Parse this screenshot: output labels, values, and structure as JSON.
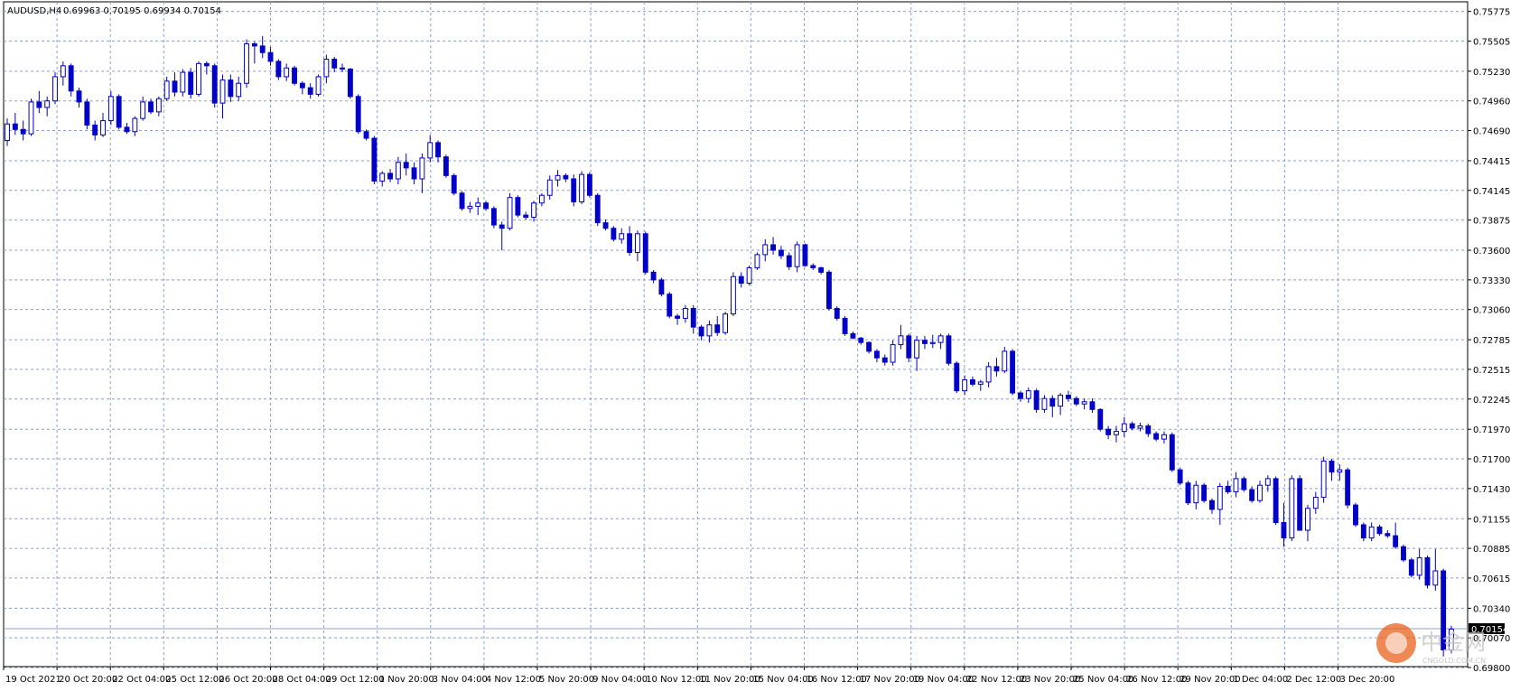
{
  "header": {
    "symbol": "AUDUSD,H4",
    "ohlc": "0.69963 0.70195 0.69934 0.70154"
  },
  "watermark": {
    "cn_text": "中金网",
    "en_text": "CNGOLD.COM.CN",
    "brand_color": "#e8601c"
  },
  "colors": {
    "candle": "#0000c8",
    "grid": "#8ca0c8",
    "price_line": "#8ca0c8",
    "price_tag_bg": "#000000",
    "price_tag_text": "#ffffff"
  },
  "chart_data": {
    "type": "candlestick",
    "symbol": "AUDUSD",
    "timeframe": "H4",
    "ylim": [
      0.698,
      0.7578
    ],
    "current_price": "0.70154",
    "grid": true,
    "y_ticks": [
      "0.75775",
      "0.75505",
      "0.75230",
      "0.74960",
      "0.74690",
      "0.74415",
      "0.74145",
      "0.73875",
      "0.73600",
      "0.73330",
      "0.73060",
      "0.72785",
      "0.72515",
      "0.72245",
      "0.71970",
      "0.71700",
      "0.71430",
      "0.71155",
      "0.70885",
      "0.70615",
      "0.70340",
      "0.70070",
      "0.69800"
    ],
    "x_ticks": [
      "19 Oct 2021",
      "20 Oct 20:00",
      "22 Oct 04:00",
      "25 Oct 12:00",
      "26 Oct 20:00",
      "28 Oct 04:00",
      "29 Oct 12:00",
      "1 Nov 20:00",
      "3 Nov 04:00",
      "4 Nov 12:00",
      "5 Nov 20:00",
      "9 Nov 04:00",
      "10 Nov 12:00",
      "11 Nov 20:00",
      "15 Nov 04:00",
      "16 Nov 12:00",
      "17 Nov 20:00",
      "19 Nov 04:00",
      "22 Nov 12:00",
      "23 Nov 20:00",
      "25 Nov 04:00",
      "26 Nov 12:00",
      "29 Nov 20:00",
      "1 Dec 04:00",
      "2 Dec 12:00",
      "3 Dec 20:00"
    ],
    "candles": [
      [
        0.746,
        0.748,
        0.7455,
        0.7475
      ],
      [
        0.7475,
        0.7485,
        0.7465,
        0.747
      ],
      [
        0.747,
        0.7478,
        0.746,
        0.7466
      ],
      [
        0.7466,
        0.7498,
        0.7464,
        0.7495
      ],
      [
        0.7495,
        0.7505,
        0.7485,
        0.749
      ],
      [
        0.749,
        0.75,
        0.7482,
        0.7496
      ],
      [
        0.7496,
        0.7522,
        0.7493,
        0.7518
      ],
      [
        0.7518,
        0.7532,
        0.751,
        0.7528
      ],
      [
        0.7528,
        0.753,
        0.75,
        0.7505
      ],
      [
        0.7505,
        0.7508,
        0.749,
        0.7495
      ],
      [
        0.7495,
        0.7498,
        0.747,
        0.7474
      ],
      [
        0.7474,
        0.7478,
        0.746,
        0.7465
      ],
      [
        0.7465,
        0.7485,
        0.7463,
        0.7478
      ],
      [
        0.7478,
        0.7505,
        0.7474,
        0.75
      ],
      [
        0.75,
        0.7502,
        0.747,
        0.7472
      ],
      [
        0.7472,
        0.7476,
        0.7466,
        0.7468
      ],
      [
        0.7468,
        0.7482,
        0.7464,
        0.748
      ],
      [
        0.748,
        0.75,
        0.7478,
        0.7495
      ],
      [
        0.7495,
        0.7498,
        0.7484,
        0.7486
      ],
      [
        0.7486,
        0.75,
        0.7482,
        0.7498
      ],
      [
        0.7498,
        0.7518,
        0.7496,
        0.7514
      ],
      [
        0.7514,
        0.7522,
        0.75,
        0.7504
      ],
      [
        0.7504,
        0.7525,
        0.75,
        0.7522
      ],
      [
        0.7522,
        0.7526,
        0.7498,
        0.7502
      ],
      [
        0.7502,
        0.7532,
        0.75,
        0.753
      ],
      [
        0.753,
        0.7532,
        0.752,
        0.7528
      ],
      [
        0.7528,
        0.753,
        0.749,
        0.7494
      ],
      [
        0.7494,
        0.752,
        0.748,
        0.7515
      ],
      [
        0.7515,
        0.752,
        0.7495,
        0.75
      ],
      [
        0.75,
        0.7518,
        0.7496,
        0.7512
      ],
      [
        0.7512,
        0.7552,
        0.7508,
        0.7548
      ],
      [
        0.7548,
        0.755,
        0.753,
        0.7546
      ],
      [
        0.7546,
        0.7555,
        0.7535,
        0.754
      ],
      [
        0.754,
        0.7545,
        0.7528,
        0.7532
      ],
      [
        0.7532,
        0.7534,
        0.7515,
        0.7518
      ],
      [
        0.7518,
        0.753,
        0.7514,
        0.7526
      ],
      [
        0.7526,
        0.7528,
        0.751,
        0.7512
      ],
      [
        0.7512,
        0.7514,
        0.7502,
        0.7508
      ],
      [
        0.7508,
        0.7512,
        0.7498,
        0.7502
      ],
      [
        0.7502,
        0.752,
        0.75,
        0.7518
      ],
      [
        0.7518,
        0.7538,
        0.7512,
        0.7534
      ],
      [
        0.7534,
        0.7536,
        0.7522,
        0.7526
      ],
      [
        0.7526,
        0.753,
        0.7522,
        0.7525
      ],
      [
        0.7525,
        0.7526,
        0.7498,
        0.75
      ],
      [
        0.75,
        0.7502,
        0.7466,
        0.7468
      ],
      [
        0.7468,
        0.747,
        0.746,
        0.7462
      ],
      [
        0.7462,
        0.7464,
        0.742,
        0.7423
      ],
      [
        0.7423,
        0.7432,
        0.7418,
        0.743
      ],
      [
        0.743,
        0.7434,
        0.7422,
        0.7425
      ],
      [
        0.7425,
        0.7445,
        0.742,
        0.744
      ],
      [
        0.744,
        0.7448,
        0.7428,
        0.7435
      ],
      [
        0.7435,
        0.744,
        0.742,
        0.7425
      ],
      [
        0.7425,
        0.7448,
        0.7412,
        0.7444
      ],
      [
        0.7444,
        0.7465,
        0.744,
        0.7458
      ],
      [
        0.7458,
        0.746,
        0.744,
        0.7445
      ],
      [
        0.7445,
        0.7447,
        0.7426,
        0.7428
      ],
      [
        0.7428,
        0.743,
        0.741,
        0.7412
      ],
      [
        0.7412,
        0.7414,
        0.7396,
        0.7398
      ],
      [
        0.7398,
        0.7404,
        0.7394,
        0.74
      ],
      [
        0.74,
        0.7408,
        0.7392,
        0.7403
      ],
      [
        0.7403,
        0.7405,
        0.7396,
        0.7398
      ],
      [
        0.7398,
        0.74,
        0.738,
        0.7383
      ],
      [
        0.7383,
        0.7386,
        0.736,
        0.738
      ],
      [
        0.738,
        0.7412,
        0.7378,
        0.7408
      ],
      [
        0.7408,
        0.741,
        0.739,
        0.7392
      ],
      [
        0.7392,
        0.7395,
        0.7388,
        0.739
      ],
      [
        0.739,
        0.7405,
        0.7386,
        0.7403
      ],
      [
        0.7403,
        0.7412,
        0.74,
        0.741
      ],
      [
        0.741,
        0.7428,
        0.7406,
        0.7424
      ],
      [
        0.7424,
        0.7433,
        0.7418,
        0.7428
      ],
      [
        0.7428,
        0.743,
        0.7422,
        0.7425
      ],
      [
        0.7425,
        0.7429,
        0.74,
        0.7404
      ],
      [
        0.7404,
        0.7432,
        0.7402,
        0.7429
      ],
      [
        0.7429,
        0.7431,
        0.7408,
        0.741
      ],
      [
        0.741,
        0.7412,
        0.7382,
        0.7385
      ],
      [
        0.7385,
        0.7388,
        0.7378,
        0.738
      ],
      [
        0.738,
        0.7382,
        0.7368,
        0.737
      ],
      [
        0.737,
        0.738,
        0.7366,
        0.7375
      ],
      [
        0.7375,
        0.7382,
        0.7355,
        0.7358
      ],
      [
        0.7358,
        0.7378,
        0.735,
        0.7375
      ],
      [
        0.7375,
        0.7377,
        0.7338,
        0.734
      ],
      [
        0.734,
        0.7342,
        0.733,
        0.7333
      ],
      [
        0.7333,
        0.7335,
        0.7318,
        0.732
      ],
      [
        0.732,
        0.7322,
        0.7298,
        0.73
      ],
      [
        0.73,
        0.7302,
        0.7292,
        0.7298
      ],
      [
        0.7298,
        0.731,
        0.7294,
        0.7307
      ],
      [
        0.7307,
        0.731,
        0.7284,
        0.729
      ],
      [
        0.729,
        0.7292,
        0.7278,
        0.7282
      ],
      [
        0.7282,
        0.7296,
        0.7276,
        0.7292
      ],
      [
        0.7292,
        0.73,
        0.7282,
        0.7285
      ],
      [
        0.7285,
        0.7304,
        0.7283,
        0.7302
      ],
      [
        0.7302,
        0.734,
        0.73,
        0.7336
      ],
      [
        0.7336,
        0.734,
        0.7326,
        0.733
      ],
      [
        0.733,
        0.7346,
        0.7328,
        0.7344
      ],
      [
        0.7344,
        0.7358,
        0.7342,
        0.7356
      ],
      [
        0.7356,
        0.737,
        0.735,
        0.7365
      ],
      [
        0.7365,
        0.7372,
        0.7356,
        0.736
      ],
      [
        0.736,
        0.7364,
        0.7352,
        0.7355
      ],
      [
        0.7355,
        0.7358,
        0.7342,
        0.7345
      ],
      [
        0.7345,
        0.7368,
        0.734,
        0.7365
      ],
      [
        0.7365,
        0.7366,
        0.7345,
        0.7346
      ],
      [
        0.7346,
        0.7348,
        0.7342,
        0.7344
      ],
      [
        0.7344,
        0.7345,
        0.7338,
        0.734
      ],
      [
        0.734,
        0.7342,
        0.7305,
        0.7307
      ],
      [
        0.7307,
        0.7309,
        0.7296,
        0.7298
      ],
      [
        0.7298,
        0.73,
        0.7282,
        0.7284
      ],
      [
        0.7284,
        0.7286,
        0.7279,
        0.728
      ],
      [
        0.728,
        0.7281,
        0.7274,
        0.7276
      ],
      [
        0.7276,
        0.7277,
        0.7266,
        0.7268
      ],
      [
        0.7268,
        0.727,
        0.7258,
        0.7262
      ],
      [
        0.7262,
        0.7265,
        0.7255,
        0.7258
      ],
      [
        0.7258,
        0.7278,
        0.7255,
        0.7274
      ],
      [
        0.7274,
        0.7292,
        0.727,
        0.7282
      ],
      [
        0.7282,
        0.7284,
        0.7258,
        0.7262
      ],
      [
        0.7262,
        0.7282,
        0.725,
        0.7278
      ],
      [
        0.7278,
        0.7282,
        0.727,
        0.7275
      ],
      [
        0.7275,
        0.7283,
        0.7271,
        0.7276
      ],
      [
        0.7276,
        0.7284,
        0.727,
        0.7282
      ],
      [
        0.7282,
        0.7284,
        0.7255,
        0.7257
      ],
      [
        0.7257,
        0.7259,
        0.723,
        0.7232
      ],
      [
        0.7232,
        0.7246,
        0.7228,
        0.7242
      ],
      [
        0.7242,
        0.7245,
        0.7236,
        0.7238
      ],
      [
        0.7238,
        0.7242,
        0.7232,
        0.724
      ],
      [
        0.724,
        0.7258,
        0.7235,
        0.7254
      ],
      [
        0.7254,
        0.7262,
        0.7245,
        0.725
      ],
      [
        0.725,
        0.7272,
        0.7248,
        0.7268
      ],
      [
        0.7268,
        0.727,
        0.7228,
        0.723
      ],
      [
        0.723,
        0.7232,
        0.7222,
        0.7225
      ],
      [
        0.7225,
        0.7235,
        0.7221,
        0.7232
      ],
      [
        0.7232,
        0.7234,
        0.7212,
        0.7215
      ],
      [
        0.7215,
        0.7228,
        0.7212,
        0.7225
      ],
      [
        0.7225,
        0.7228,
        0.7208,
        0.7218
      ],
      [
        0.7218,
        0.723,
        0.721,
        0.7228
      ],
      [
        0.7228,
        0.7232,
        0.7222,
        0.7225
      ],
      [
        0.7225,
        0.7227,
        0.7218,
        0.722
      ],
      [
        0.722,
        0.7225,
        0.7215,
        0.7222
      ],
      [
        0.7222,
        0.7225,
        0.7212,
        0.7215
      ],
      [
        0.7215,
        0.7216,
        0.7195,
        0.7197
      ],
      [
        0.7197,
        0.72,
        0.7188,
        0.7192
      ],
      [
        0.7192,
        0.72,
        0.7185,
        0.7195
      ],
      [
        0.7195,
        0.7208,
        0.719,
        0.7202
      ],
      [
        0.7202,
        0.7204,
        0.7196,
        0.7198
      ],
      [
        0.7198,
        0.7203,
        0.7195,
        0.72
      ],
      [
        0.72,
        0.7202,
        0.719,
        0.7193
      ],
      [
        0.7193,
        0.7195,
        0.7186,
        0.7188
      ],
      [
        0.7188,
        0.7195,
        0.7184,
        0.7192
      ],
      [
        0.7192,
        0.7194,
        0.7158,
        0.716
      ],
      [
        0.716,
        0.7162,
        0.7146,
        0.7148
      ],
      [
        0.7148,
        0.715,
        0.7128,
        0.713
      ],
      [
        0.713,
        0.715,
        0.7124,
        0.7146
      ],
      [
        0.7146,
        0.7148,
        0.713,
        0.7132
      ],
      [
        0.7132,
        0.7134,
        0.712,
        0.7124
      ],
      [
        0.7124,
        0.7148,
        0.711,
        0.7145
      ],
      [
        0.7145,
        0.715,
        0.7138,
        0.714
      ],
      [
        0.714,
        0.7158,
        0.7135,
        0.7152
      ],
      [
        0.7152,
        0.7154,
        0.714,
        0.7142
      ],
      [
        0.7142,
        0.7145,
        0.713,
        0.7132
      ],
      [
        0.7132,
        0.715,
        0.713,
        0.7146
      ],
      [
        0.7146,
        0.7155,
        0.714,
        0.7152
      ],
      [
        0.7152,
        0.7154,
        0.711,
        0.7112
      ],
      [
        0.7112,
        0.713,
        0.709,
        0.7098
      ],
      [
        0.7098,
        0.7155,
        0.7095,
        0.7152
      ],
      [
        0.7152,
        0.7155,
        0.711,
        0.7105
      ],
      [
        0.7105,
        0.7128,
        0.7095,
        0.7125
      ],
      [
        0.7125,
        0.714,
        0.712,
        0.7135
      ],
      [
        0.7135,
        0.7172,
        0.713,
        0.7168
      ],
      [
        0.7168,
        0.717,
        0.715,
        0.7158
      ],
      [
        0.7158,
        0.7165,
        0.715,
        0.716
      ],
      [
        0.716,
        0.7162,
        0.7125,
        0.7128
      ],
      [
        0.7128,
        0.713,
        0.7108,
        0.711
      ],
      [
        0.711,
        0.7112,
        0.7095,
        0.7098
      ],
      [
        0.7098,
        0.7112,
        0.7095,
        0.7108
      ],
      [
        0.7108,
        0.711,
        0.71,
        0.7102
      ],
      [
        0.7102,
        0.7105,
        0.7098,
        0.71
      ],
      [
        0.71,
        0.7112,
        0.7088,
        0.709
      ],
      [
        0.709,
        0.7092,
        0.7076,
        0.7078
      ],
      [
        0.7078,
        0.708,
        0.7062,
        0.7064
      ],
      [
        0.7064,
        0.7088,
        0.706,
        0.708
      ],
      [
        0.708,
        0.7082,
        0.7052,
        0.7055
      ],
      [
        0.7055,
        0.7088,
        0.705,
        0.7068
      ],
      [
        0.7068,
        0.707,
        0.699,
        0.6996
      ],
      [
        0.6996,
        0.7018,
        0.6993,
        0.7015
      ]
    ]
  }
}
